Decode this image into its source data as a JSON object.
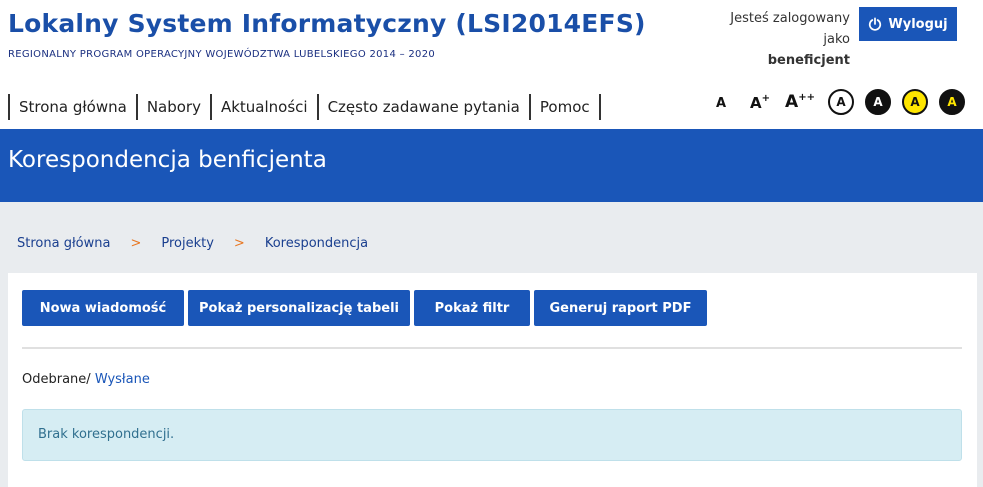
{
  "header": {
    "title": "Lokalny System Informatyczny (LSI2014EFS)",
    "subtitle": "REGIONALNY PROGRAM OPERACYJNY WOJEWÓDZTWA LUBELSKIEGO 2014 – 2020",
    "login_prefix": "Jesteś zalogowany jako",
    "login_user": "beneficjent",
    "logout_label": "Wyloguj"
  },
  "nav": {
    "items": [
      "Strona główna",
      "Nabory",
      "Aktualności",
      "Często zadawane pytania",
      "Pomoc"
    ]
  },
  "accessibility": {
    "font_small": "A",
    "font_medium": "A",
    "font_medium_sup": "+",
    "font_large": "A",
    "font_large_sup": "++",
    "contrast_labels": [
      "A",
      "A",
      "A",
      "A"
    ]
  },
  "banner": {
    "title": "Korespondencja benficjenta"
  },
  "breadcrumb": {
    "items": [
      "Strona główna",
      "Projekty",
      "Korespondencja"
    ],
    "separator": ">"
  },
  "toolbar": {
    "new_message": "Nowa wiadomość",
    "table_personalization": "Pokaż personalizację tabeli",
    "show_filter": "Pokaż filtr",
    "pdf_report": "Generuj raport PDF"
  },
  "mailbox": {
    "received": "Odebrane",
    "separator": "/",
    "sent": "Wysłane"
  },
  "alert": {
    "message": "Brak korespondencji."
  },
  "colors": {
    "primary": "#1a56b8",
    "title": "#1a4fa8",
    "breadcrumb_separator": "#e87722",
    "alert_bg": "#d6edf3",
    "contrast_yellow": "#ffe600"
  }
}
